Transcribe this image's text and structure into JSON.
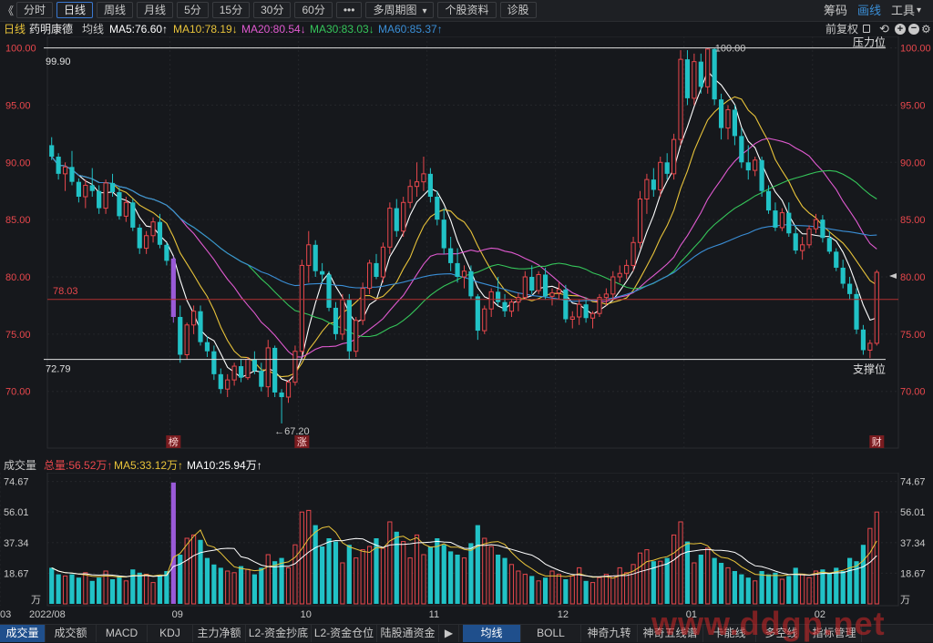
{
  "toolbar": {
    "back": "《",
    "items": [
      "分时",
      "日线",
      "周线",
      "月线",
      "5分",
      "15分",
      "30分",
      "60分",
      "•••",
      "多周期图",
      "个股资料",
      "诊股"
    ],
    "multi_caret": "▾",
    "right": [
      "筹码",
      "画线",
      "工具"
    ],
    "right_caret": "▾"
  },
  "legend": {
    "period": "日线",
    "name": "药明康德",
    "type": "均线",
    "ma5": "MA5:76.60↑",
    "ma10": "MA10:78.19↓",
    "ma20": "MA20:80.54↓",
    "ma30": "MA30:83.03↓",
    "ma60": "MA60:85.37↑",
    "restore": "前复权",
    "icons": [
      "lock-icon",
      "undo-icon",
      "zoom-in-icon",
      "zoom-out-icon",
      "settings-icon"
    ]
  },
  "price_axis": {
    "labels": [
      "100.00",
      "95.00",
      "90.00",
      "85.00",
      "80.00",
      "75.00",
      "70.00"
    ],
    "resistance_label": "压力位",
    "support_label": "支撑位",
    "resistance_value": "99.90",
    "support_value": "72.79",
    "current_line_value": "78.03",
    "high_marker": "100.00",
    "low_marker": "←67.20",
    "markers": [
      "榜",
      "涨",
      "财"
    ]
  },
  "volume": {
    "title": "成交量",
    "total": "总量:56.52万↑",
    "ma5": "MA5:33.12万↑",
    "ma10": "MA10:25.94万↑",
    "axis": [
      "74.67",
      "56.01",
      "37.34",
      "18.67",
      "万"
    ],
    "x_labels": [
      "2022/08",
      "09",
      "10",
      "11",
      "12",
      "01",
      "02",
      "03"
    ]
  },
  "bottom_tabs": [
    "成交量",
    "成交额",
    "MACD",
    "KDJ",
    "主力净额",
    "L2-资金抄底",
    "L2-资金仓位",
    "陆股通资金",
    "均线",
    "BOLL",
    "神奇九转",
    "神奇五线谱",
    "卡能线",
    "多空线",
    "指标管理"
  ],
  "bottom_arrow": "▶",
  "watermark": "www.ddgp.net",
  "colors": {
    "up": "#e8474c",
    "down": "#21c2c6",
    "ma5": "#ffffff",
    "ma10": "#e8c33a",
    "ma20": "#e05ad0",
    "ma30": "#35c55a",
    "ma60": "#3a8ed6",
    "special": "#9a5ad8"
  },
  "chart_data": {
    "type": "candlestick",
    "ylim": [
      66,
      101
    ],
    "ohlc": [
      [
        91.5,
        92.2,
        90.2,
        90.5
      ],
      [
        90.5,
        90.8,
        88.5,
        89.0
      ],
      [
        89.0,
        90.0,
        87.5,
        89.6
      ],
      [
        89.6,
        91.0,
        88.0,
        88.3
      ],
      [
        88.3,
        88.6,
        86.5,
        87.0
      ],
      [
        87.0,
        88.5,
        86.0,
        88.0
      ],
      [
        88.0,
        89.5,
        87.0,
        87.5
      ],
      [
        87.5,
        88.0,
        85.5,
        86.0
      ],
      [
        86.0,
        88.5,
        85.5,
        88.2
      ],
      [
        88.2,
        89.0,
        87.0,
        87.4
      ],
      [
        87.4,
        87.8,
        85.0,
        85.3
      ],
      [
        85.3,
        87.0,
        84.8,
        86.5
      ],
      [
        86.5,
        86.8,
        84.0,
        84.3
      ],
      [
        84.3,
        84.6,
        82.0,
        82.5
      ],
      [
        82.5,
        84.0,
        82.0,
        83.6
      ],
      [
        83.6,
        85.2,
        83.0,
        84.8
      ],
      [
        84.8,
        85.5,
        82.5,
        82.8
      ],
      [
        82.8,
        83.0,
        81.0,
        81.4
      ],
      [
        81.6,
        81.8,
        76.0,
        76.5
      ],
      [
        76.5,
        77.5,
        72.5,
        73.2
      ],
      [
        73.2,
        76.0,
        72.8,
        75.8
      ],
      [
        75.8,
        77.5,
        75.0,
        77.0
      ],
      [
        77.0,
        77.5,
        74.0,
        74.3
      ],
      [
        74.3,
        74.8,
        73.0,
        73.5
      ],
      [
        73.5,
        74.0,
        71.0,
        71.5
      ],
      [
        71.5,
        72.0,
        69.8,
        70.2
      ],
      [
        70.2,
        71.5,
        69.5,
        71.0
      ],
      [
        71.0,
        72.5,
        70.5,
        72.2
      ],
      [
        72.2,
        72.8,
        70.8,
        71.2
      ],
      [
        71.2,
        73.0,
        71.0,
        72.8
      ],
      [
        72.8,
        73.5,
        71.5,
        71.8
      ],
      [
        71.8,
        72.5,
        70.0,
        70.4
      ],
      [
        70.4,
        74.5,
        69.5,
        73.8
      ],
      [
        73.8,
        74.0,
        69.5,
        69.9
      ],
      [
        69.9,
        70.2,
        67.2,
        69.5
      ],
      [
        69.5,
        71.0,
        69.0,
        70.8
      ],
      [
        70.8,
        74.0,
        70.5,
        73.5
      ],
      [
        73.5,
        81.5,
        73.2,
        81.0
      ],
      [
        81.0,
        84.0,
        79.5,
        82.8
      ],
      [
        82.8,
        83.2,
        80.0,
        80.5
      ],
      [
        80.5,
        81.2,
        79.5,
        80.2
      ],
      [
        80.2,
        80.5,
        77.0,
        77.3
      ],
      [
        77.3,
        77.8,
        74.5,
        75.0
      ],
      [
        75.0,
        78.5,
        74.5,
        78.0
      ],
      [
        78.0,
        78.5,
        72.8,
        73.5
      ],
      [
        73.5,
        76.5,
        73.0,
        76.2
      ],
      [
        76.2,
        79.5,
        75.8,
        79.0
      ],
      [
        79.0,
        81.5,
        78.5,
        81.2
      ],
      [
        81.2,
        82.0,
        79.8,
        80.0
      ],
      [
        80.0,
        83.0,
        79.5,
        82.6
      ],
      [
        82.6,
        86.5,
        82.0,
        86.0
      ],
      [
        86.0,
        86.8,
        83.5,
        84.0
      ],
      [
        84.0,
        87.0,
        83.5,
        86.5
      ],
      [
        86.5,
        88.5,
        86.0,
        87.9
      ],
      [
        87.9,
        90.0,
        87.0,
        88.3
      ],
      [
        88.3,
        90.5,
        87.5,
        89.0
      ],
      [
        89.0,
        89.5,
        86.5,
        87.0
      ],
      [
        87.0,
        87.5,
        84.5,
        85.0
      ],
      [
        85.0,
        86.0,
        82.0,
        82.5
      ],
      [
        82.5,
        83.5,
        80.5,
        81.2
      ],
      [
        81.2,
        82.5,
        79.5,
        80.0
      ],
      [
        80.0,
        81.0,
        79.0,
        80.5
      ],
      [
        80.5,
        81.0,
        78.0,
        78.3
      ],
      [
        78.3,
        78.5,
        74.5,
        75.3
      ],
      [
        75.3,
        77.5,
        75.0,
        77.2
      ],
      [
        77.2,
        79.0,
        76.5,
        78.7
      ],
      [
        78.7,
        80.0,
        77.5,
        77.8
      ],
      [
        77.8,
        78.5,
        76.5,
        77.0
      ],
      [
        77.0,
        78.0,
        76.5,
        77.8
      ],
      [
        77.8,
        78.6,
        77.0,
        78.2
      ],
      [
        78.2,
        80.5,
        78.0,
        80.0
      ],
      [
        80.0,
        81.0,
        78.5,
        78.8
      ],
      [
        78.8,
        80.5,
        78.5,
        80.2
      ],
      [
        80.2,
        80.8,
        78.0,
        78.3
      ],
      [
        78.3,
        79.0,
        77.5,
        78.6
      ],
      [
        78.6,
        79.5,
        78.0,
        78.9
      ],
      [
        78.9,
        79.3,
        76.0,
        76.3
      ],
      [
        76.3,
        77.0,
        75.5,
        76.5
      ],
      [
        76.5,
        78.0,
        75.8,
        77.6
      ],
      [
        77.6,
        78.2,
        76.0,
        76.4
      ],
      [
        76.4,
        77.0,
        75.5,
        76.8
      ],
      [
        76.8,
        78.5,
        76.5,
        78.2
      ],
      [
        78.2,
        79.0,
        77.5,
        78.5
      ],
      [
        78.5,
        80.5,
        78.0,
        80.0
      ],
      [
        80.0,
        81.0,
        79.5,
        80.3
      ],
      [
        80.3,
        81.5,
        79.8,
        81.0
      ],
      [
        81.0,
        83.5,
        80.5,
        83.0
      ],
      [
        83.0,
        87.5,
        82.5,
        86.8
      ],
      [
        86.8,
        89.0,
        85.5,
        88.5
      ],
      [
        88.5,
        89.5,
        87.0,
        87.6
      ],
      [
        87.6,
        90.5,
        87.0,
        90.0
      ],
      [
        90.0,
        90.8,
        88.5,
        89.0
      ],
      [
        89.0,
        92.5,
        88.5,
        92.0
      ],
      [
        92.0,
        99.8,
        91.5,
        99.0
      ],
      [
        99.0,
        99.8,
        95.0,
        95.6
      ],
      [
        95.6,
        99.5,
        95.0,
        98.8
      ],
      [
        98.8,
        99.5,
        96.0,
        96.6
      ],
      [
        96.6,
        100.0,
        96.0,
        99.9
      ],
      [
        99.9,
        100.0,
        95.0,
        95.5
      ],
      [
        95.5,
        96.0,
        92.0,
        93.0
      ],
      [
        93.0,
        95.0,
        92.0,
        94.6
      ],
      [
        94.6,
        95.0,
        91.5,
        92.3
      ],
      [
        92.3,
        93.0,
        89.5,
        90.0
      ],
      [
        90.0,
        91.5,
        88.5,
        89.3
      ],
      [
        89.3,
        90.5,
        88.8,
        90.2
      ],
      [
        90.2,
        90.5,
        87.0,
        87.5
      ],
      [
        87.5,
        88.0,
        85.5,
        85.8
      ],
      [
        85.8,
        86.5,
        84.0,
        84.3
      ],
      [
        84.3,
        86.0,
        84.0,
        85.6
      ],
      [
        85.6,
        86.5,
        83.5,
        83.8
      ],
      [
        83.8,
        84.5,
        82.0,
        82.3
      ],
      [
        82.3,
        83.5,
        81.5,
        82.8
      ],
      [
        82.8,
        84.5,
        82.5,
        84.2
      ],
      [
        84.2,
        85.5,
        83.8,
        85.0
      ],
      [
        85.0,
        85.4,
        83.0,
        83.4
      ],
      [
        83.4,
        84.0,
        82.0,
        82.2
      ],
      [
        82.2,
        82.5,
        80.5,
        80.8
      ],
      [
        80.8,
        81.5,
        79.0,
        79.4
      ],
      [
        79.4,
        80.0,
        78.0,
        78.5
      ],
      [
        78.5,
        79.0,
        75.0,
        75.4
      ],
      [
        75.4,
        75.8,
        73.2,
        73.6
      ],
      [
        73.6,
        74.5,
        72.9,
        74.2
      ],
      [
        74.2,
        80.6,
        74.0,
        80.4
      ]
    ],
    "vol": [
      22,
      18,
      17,
      18,
      16,
      19,
      14,
      16,
      20,
      15,
      17,
      14,
      21,
      19,
      18,
      13,
      17,
      20,
      74,
      30,
      40,
      42,
      39,
      28,
      24,
      22,
      20,
      19,
      23,
      21,
      18,
      22,
      30,
      26,
      28,
      22,
      36,
      56,
      57,
      48,
      35,
      40,
      38,
      25,
      36,
      28,
      33,
      35,
      40,
      34,
      50,
      44,
      38,
      28,
      42,
      30,
      35,
      40,
      36,
      32,
      30,
      28,
      37,
      48,
      40,
      35,
      30,
      28,
      24,
      20,
      18,
      17,
      14,
      16,
      20,
      18,
      15,
      17,
      22,
      14,
      13,
      16,
      18,
      17,
      22,
      19,
      24,
      31,
      33,
      26,
      26,
      28,
      42,
      50,
      38,
      25,
      30,
      34,
      28,
      25,
      22,
      20,
      18,
      16,
      14,
      20,
      18,
      19,
      15,
      17,
      22,
      18,
      16,
      20,
      21,
      19,
      22,
      20,
      28,
      26,
      36,
      46,
      56
    ],
    "x_labels": [
      "2022/08",
      "09",
      "10",
      "11",
      "12",
      "01",
      "02",
      "03"
    ]
  }
}
